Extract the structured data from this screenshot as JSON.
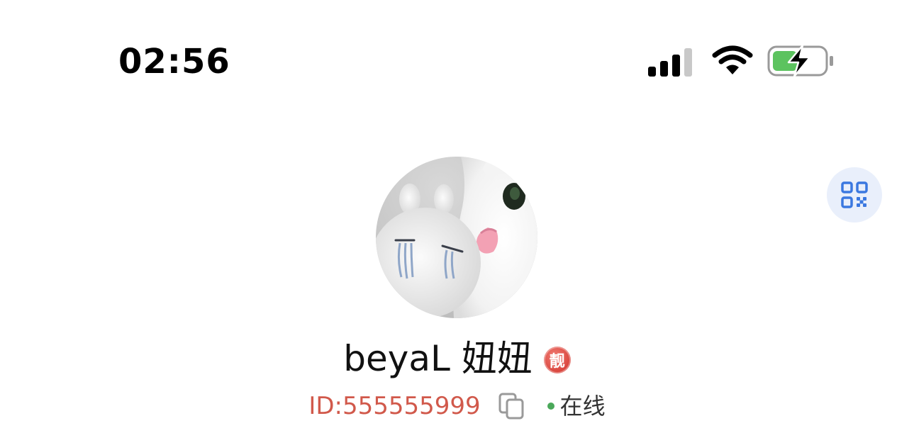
{
  "status_bar": {
    "time": "02:56",
    "icons": [
      "signal-icon",
      "wifi-icon",
      "battery-charging-icon"
    ],
    "battery_color": "#5cc35f"
  },
  "profile": {
    "avatar": "avatar-image",
    "name": "beyaL 妞妞",
    "badge_text": "靓",
    "id_text": "ID:555555999",
    "status_text": "在线"
  },
  "actions": {
    "qr_icon": "qr-code-icon",
    "copy_icon": "copy-icon"
  },
  "colors": {
    "id_red": "#d1594b",
    "badge_red": "#d9443c",
    "online_green": "#4aa85a",
    "qr_blue": "#3b78e0",
    "qr_bg": "#e9effb"
  }
}
